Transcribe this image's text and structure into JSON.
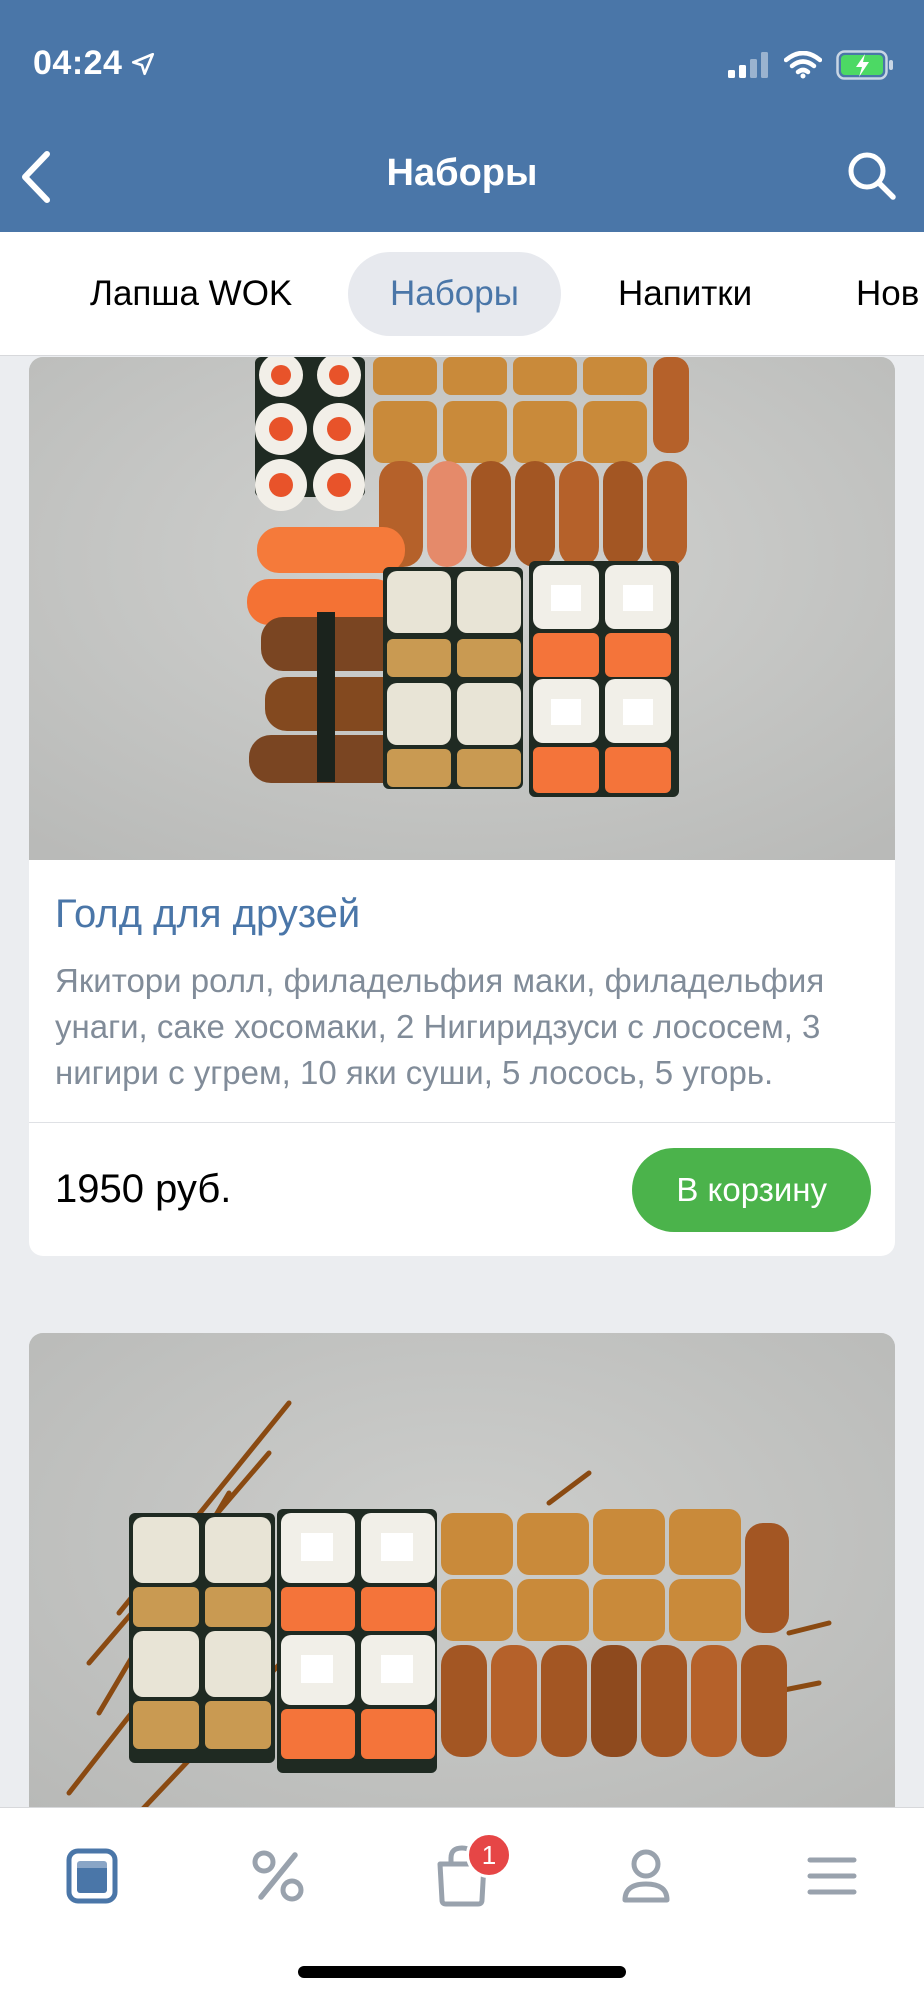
{
  "status_bar": {
    "time": "04:24"
  },
  "nav": {
    "title": "Наборы"
  },
  "category_tabs": [
    {
      "label": "Лапша WOK"
    },
    {
      "label": "Наборы",
      "active": true
    },
    {
      "label": "Напитки"
    },
    {
      "label": "Нов"
    }
  ],
  "products": [
    {
      "name": "Голд для друзей",
      "description": "Якитори ролл, филадельфия маки, филадельфия унаги, саке хосомаки, 2 Нигиридзуси с лососем, 3 нигири с угрем, 10 яки суши, 5 лосось, 5 угорь.",
      "price": "1950 руб.",
      "button_label": "В корзину"
    }
  ],
  "tabbar": {
    "items": [
      {
        "icon": "catalog-icon",
        "active": true
      },
      {
        "icon": "percent-icon"
      },
      {
        "icon": "cart-icon",
        "badge": "1"
      },
      {
        "icon": "profile-icon"
      },
      {
        "icon": "menu-icon"
      }
    ]
  },
  "colors": {
    "header": "#4a76a8",
    "accent": "#4a76a8",
    "cart_button": "#4bb34b",
    "badge": "#e64646"
  }
}
